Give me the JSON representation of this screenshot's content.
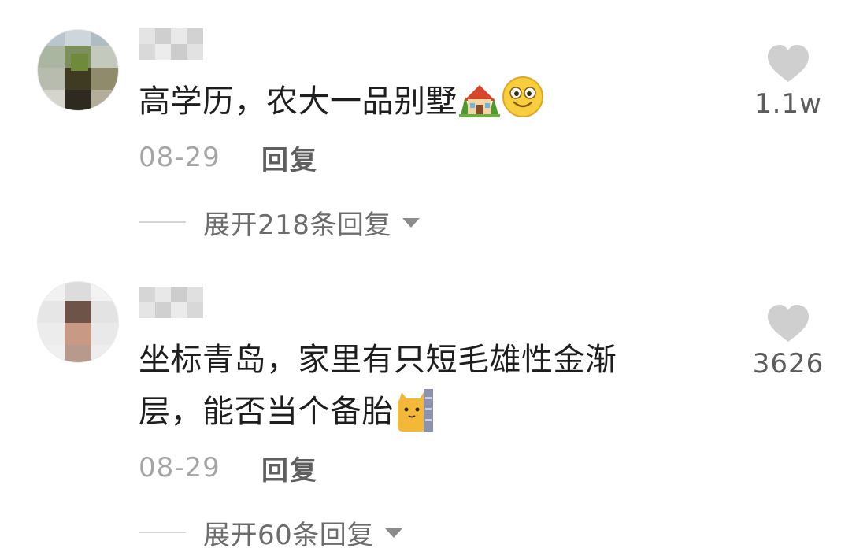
{
  "comments": [
    {
      "text": "高学历，农大一品别墅",
      "emojis": [
        "house-with-garden-emoji",
        "smiling-face-emoji"
      ],
      "date": "08-29",
      "reply_label": "回复",
      "expand_label": "展开218条回复",
      "likes": "1.1w"
    },
    {
      "text_line1": "坐标青岛，家里有只短毛雄性金渐",
      "text_line2": "层，能否当个备胎",
      "emojis": [
        "cat-peeking-behind-wall-emoji"
      ],
      "date": "08-29",
      "reply_label": "回复",
      "expand_label": "展开60条回复",
      "likes": "3626"
    }
  ],
  "colors": {
    "text": "#1e1e1e",
    "secondary": "#a5a5a5",
    "reply": "#5f5f5f",
    "heart": "#cfcfcf"
  }
}
